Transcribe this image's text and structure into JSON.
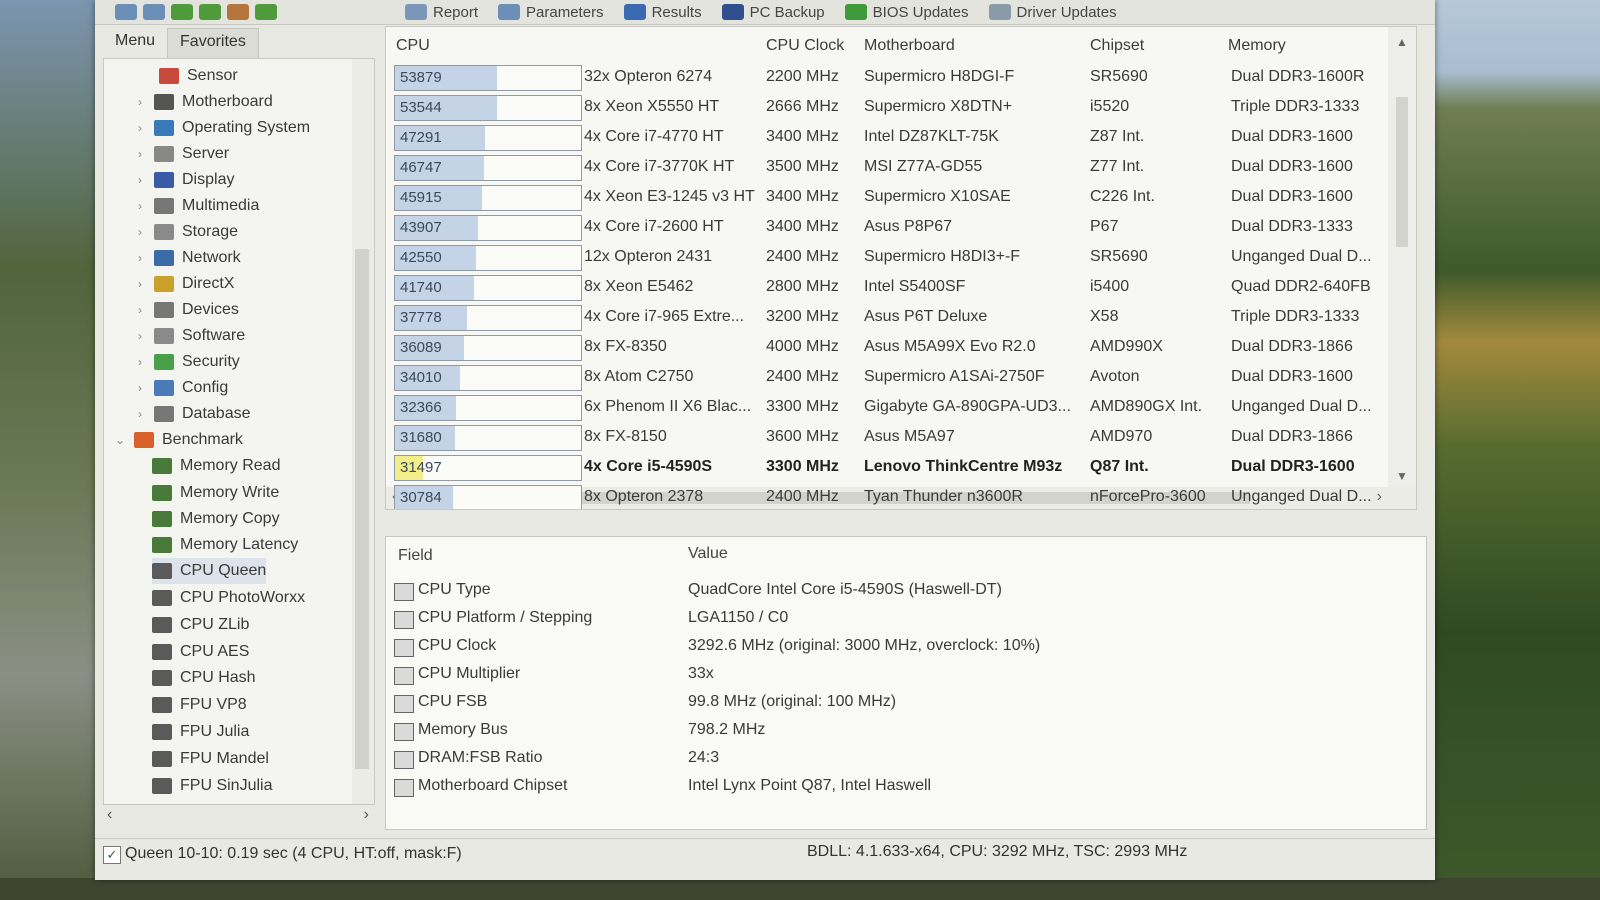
{
  "toolbar": {
    "items": [
      {
        "label": "Report",
        "color": "#7a96b8"
      },
      {
        "label": "Parameters",
        "color": "#6c8fb8"
      },
      {
        "label": "Results",
        "color": "#3a6ab0"
      },
      {
        "label": "PC Backup",
        "color": "#2f4f8f"
      },
      {
        "label": "BIOS Updates",
        "color": "#3f9a3a"
      },
      {
        "label": "Driver Updates",
        "color": "#8a9aa8"
      }
    ]
  },
  "left_tabs": [
    "Menu",
    "Favorites"
  ],
  "tree": [
    {
      "label": "Sensor",
      "icon": "sensor-icon",
      "color": "#c84a3a"
    },
    {
      "label": "Motherboard",
      "icon": "motherboard-icon",
      "color": "#555555"
    },
    {
      "label": "Operating System",
      "icon": "windows-icon",
      "color": "#3a7ab8"
    },
    {
      "label": "Server",
      "icon": "server-icon",
      "color": "#888888"
    },
    {
      "label": "Display",
      "icon": "display-icon",
      "color": "#3a5aa8"
    },
    {
      "label": "Multimedia",
      "icon": "speaker-icon",
      "color": "#777777"
    },
    {
      "label": "Storage",
      "icon": "storage-icon",
      "color": "#8a8a8a"
    },
    {
      "label": "Network",
      "icon": "network-icon",
      "color": "#3a6aa8"
    },
    {
      "label": "DirectX",
      "icon": "directx-icon",
      "color": "#c8a02a"
    },
    {
      "label": "Devices",
      "icon": "devices-icon",
      "color": "#777777"
    },
    {
      "label": "Software",
      "icon": "software-icon",
      "color": "#8a8a8a"
    },
    {
      "label": "Security",
      "icon": "security-icon",
      "color": "#4aa04a"
    },
    {
      "label": "Config",
      "icon": "config-icon",
      "color": "#4a7ab8"
    },
    {
      "label": "Database",
      "icon": "database-icon",
      "color": "#777777"
    },
    {
      "label": "Benchmark",
      "icon": "benchmark-icon",
      "color": "#d8602a"
    },
    {
      "label": "Memory Read",
      "icon": "memory-icon",
      "color": "#4a7a3a"
    },
    {
      "label": "Memory Write",
      "icon": "memory-icon",
      "color": "#4a7a3a"
    },
    {
      "label": "Memory Copy",
      "icon": "memory-icon",
      "color": "#4a7a3a"
    },
    {
      "label": "Memory Latency",
      "icon": "memory-icon",
      "color": "#4a7a3a"
    },
    {
      "label": "CPU Queen",
      "icon": "cpu-icon",
      "color": "#5a5a5a"
    },
    {
      "label": "CPU PhotoWorxx",
      "icon": "cpu-icon",
      "color": "#5a5a5a"
    },
    {
      "label": "CPU ZLib",
      "icon": "cpu-icon",
      "color": "#5a5a5a"
    },
    {
      "label": "CPU AES",
      "icon": "cpu-icon",
      "color": "#5a5a5a"
    },
    {
      "label": "CPU Hash",
      "icon": "cpu-icon",
      "color": "#5a5a5a"
    },
    {
      "label": "FPU VP8",
      "icon": "fpu-icon",
      "color": "#5a5a5a"
    },
    {
      "label": "FPU Julia",
      "icon": "fpu-icon",
      "color": "#5a5a5a"
    },
    {
      "label": "FPU Mandel",
      "icon": "fpu-icon",
      "color": "#5a5a5a"
    },
    {
      "label": "FPU SinJulia",
      "icon": "fpu-icon",
      "color": "#5a5a5a"
    }
  ],
  "table": {
    "headers": [
      "CPU",
      "CPU Clock",
      "Motherboard",
      "Chipset",
      "Memory"
    ],
    "max_score": 53879,
    "rows": [
      {
        "score": "53879",
        "cpu": "32x Opteron 6274",
        "clock": "2200 MHz",
        "mb": "Supermicro H8DGI-F",
        "chipset": "SR5690",
        "memory": "Dual DDR3-1600R"
      },
      {
        "score": "53544",
        "cpu": "8x Xeon X5550 HT",
        "clock": "2666 MHz",
        "mb": "Supermicro X8DTN+",
        "chipset": "i5520",
        "memory": "Triple DDR3-1333"
      },
      {
        "score": "47291",
        "cpu": "4x Core i7-4770 HT",
        "clock": "3400 MHz",
        "mb": "Intel DZ87KLT-75K",
        "chipset": "Z87 Int.",
        "memory": "Dual DDR3-1600"
      },
      {
        "score": "46747",
        "cpu": "4x Core i7-3770K HT",
        "clock": "3500 MHz",
        "mb": "MSI Z77A-GD55",
        "chipset": "Z77 Int.",
        "memory": "Dual DDR3-1600"
      },
      {
        "score": "45915",
        "cpu": "4x Xeon E3-1245 v3 HT",
        "clock": "3400 MHz",
        "mb": "Supermicro X10SAE",
        "chipset": "C226 Int.",
        "memory": "Dual DDR3-1600"
      },
      {
        "score": "43907",
        "cpu": "4x Core i7-2600 HT",
        "clock": "3400 MHz",
        "mb": "Asus P8P67",
        "chipset": "P67",
        "memory": "Dual DDR3-1333"
      },
      {
        "score": "42550",
        "cpu": "12x Opteron 2431",
        "clock": "2400 MHz",
        "mb": "Supermicro H8DI3+-F",
        "chipset": "SR5690",
        "memory": "Unganged Dual D..."
      },
      {
        "score": "41740",
        "cpu": "8x Xeon E5462",
        "clock": "2800 MHz",
        "mb": "Intel S5400SF",
        "chipset": "i5400",
        "memory": "Quad DDR2-640FB"
      },
      {
        "score": "37778",
        "cpu": "4x Core i7-965 Extre...",
        "clock": "3200 MHz",
        "mb": "Asus P6T Deluxe",
        "chipset": "X58",
        "memory": "Triple DDR3-1333"
      },
      {
        "score": "36089",
        "cpu": "8x FX-8350",
        "clock": "4000 MHz",
        "mb": "Asus M5A99X Evo R2.0",
        "chipset": "AMD990X",
        "memory": "Dual DDR3-1866"
      },
      {
        "score": "34010",
        "cpu": "8x Atom C2750",
        "clock": "2400 MHz",
        "mb": "Supermicro A1SAi-2750F",
        "chipset": "Avoton",
        "memory": "Dual DDR3-1600"
      },
      {
        "score": "32366",
        "cpu": "6x Phenom II X6 Blac...",
        "clock": "3300 MHz",
        "mb": "Gigabyte GA-890GPA-UD3...",
        "chipset": "AMD890GX Int.",
        "memory": "Unganged Dual D..."
      },
      {
        "score": "31680",
        "cpu": "8x FX-8150",
        "clock": "3600 MHz",
        "mb": "Asus M5A97",
        "chipset": "AMD970",
        "memory": "Dual DDR3-1866"
      },
      {
        "score": "31497",
        "cpu": "4x Core i5-4590S",
        "clock": "3300 MHz",
        "mb": "Lenovo ThinkCentre M93z",
        "chipset": "Q87 Int.",
        "memory": "Dual DDR3-1600",
        "highlight": true
      },
      {
        "score": "30784",
        "cpu": "8x Opteron 2378",
        "clock": "2400 MHz",
        "mb": "Tyan Thunder n3600R",
        "chipset": "nForcePro-3600",
        "memory": "Unganged Dual D..."
      }
    ]
  },
  "details": {
    "headers": [
      "Field",
      "Value"
    ],
    "rows": [
      {
        "field": "CPU Type",
        "value": "QuadCore Intel Core i5-4590S  (Haswell-DT)",
        "icon": "cpu-icon"
      },
      {
        "field": "CPU Platform / Stepping",
        "value": "LGA1150 / C0",
        "icon": "cpu-icon"
      },
      {
        "field": "CPU Clock",
        "value": "3292.6 MHz  (original: 3000 MHz, overclock: 10%)",
        "icon": "cpu-icon"
      },
      {
        "field": "CPU Multiplier",
        "value": "33x",
        "icon": "cpu-icon"
      },
      {
        "field": "CPU FSB",
        "value": "99.8 MHz  (original: 100 MHz)",
        "icon": "cpu-icon"
      },
      {
        "field": "Memory Bus",
        "value": "798.2 MHz",
        "icon": "memory-icon"
      },
      {
        "field": "DRAM:FSB Ratio",
        "value": "24:3",
        "icon": "memory-icon"
      },
      {
        "field": "Motherboard Chipset",
        "value": "Intel Lynx Point Q87, Intel Haswell",
        "icon": "chipset-icon"
      }
    ]
  },
  "status": {
    "left": "Queen 10-10: 0.19 sec (4 CPU, HT:off, mask:F)",
    "right": "BDLL: 4.1.633-x64, CPU: 3292 MHz, TSC: 2993 MHz"
  }
}
